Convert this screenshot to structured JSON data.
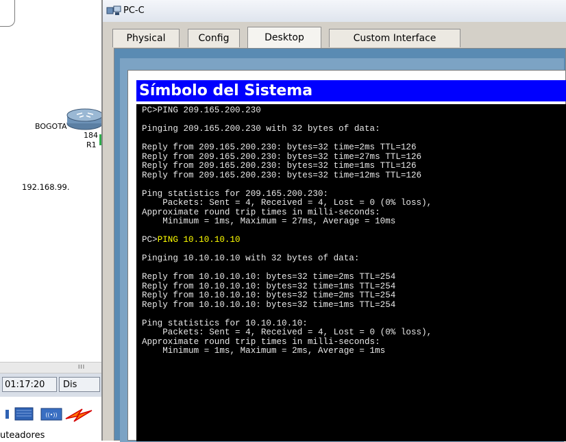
{
  "workspace": {
    "device_name": "BOGOTA",
    "device_model": "184",
    "device_id": "R1",
    "ip_label": "192.168.99.",
    "time": "01:17:20",
    "dis_label": "Dis",
    "category_label": "uteadores",
    "scroll_grip": "III"
  },
  "window": {
    "title": "PC-C",
    "tabs": [
      {
        "label": "Physical"
      },
      {
        "label": "Config"
      },
      {
        "label": "Desktop",
        "active": true
      },
      {
        "label": "Custom Interface"
      }
    ]
  },
  "dialog": {
    "title": "Símbolo del Sistema"
  },
  "terminal": {
    "lines": [
      {
        "text": "PC>PING 209.165.200.230"
      },
      {
        "text": ""
      },
      {
        "text": "Pinging 209.165.200.230 with 32 bytes of data:"
      },
      {
        "text": ""
      },
      {
        "text": "Reply from 209.165.200.230: bytes=32 time=2ms TTL=126"
      },
      {
        "text": "Reply from 209.165.200.230: bytes=32 time=27ms TTL=126"
      },
      {
        "text": "Reply from 209.165.200.230: bytes=32 time=1ms TTL=126"
      },
      {
        "text": "Reply from 209.165.200.230: bytes=32 time=12ms TTL=126"
      },
      {
        "text": ""
      },
      {
        "text": "Ping statistics for 209.165.200.230:"
      },
      {
        "text": "    Packets: Sent = 4, Received = 4, Lost = 0 (0% loss),"
      },
      {
        "text": "Approximate round trip times in milli-seconds:"
      },
      {
        "text": "    Minimum = 1ms, Maximum = 27ms, Average = 10ms"
      },
      {
        "text": ""
      },
      {
        "prompt": "PC>",
        "command": "PING 10.10.10.10",
        "highlight": true
      },
      {
        "text": ""
      },
      {
        "text": "Pinging 10.10.10.10 with 32 bytes of data:"
      },
      {
        "text": ""
      },
      {
        "text": "Reply from 10.10.10.10: bytes=32 time=2ms TTL=254"
      },
      {
        "text": "Reply from 10.10.10.10: bytes=32 time=1ms TTL=254"
      },
      {
        "text": "Reply from 10.10.10.10: bytes=32 time=2ms TTL=254"
      },
      {
        "text": "Reply from 10.10.10.10: bytes=32 time=1ms TTL=254"
      },
      {
        "text": ""
      },
      {
        "text": "Ping statistics for 10.10.10.10:"
      },
      {
        "text": "    Packets: Sent = 4, Received = 4, Lost = 0 (0% loss),"
      },
      {
        "text": "Approximate round trip times in milli-seconds:"
      },
      {
        "text": "    Minimum = 1ms, Maximum = 2ms, Average = 1ms"
      }
    ]
  },
  "colors": {
    "dialog_title_bg": "#0000ff",
    "terminal_bg": "#000000",
    "terminal_text": "#e8e8e8",
    "command_highlight": "#ffff00"
  }
}
